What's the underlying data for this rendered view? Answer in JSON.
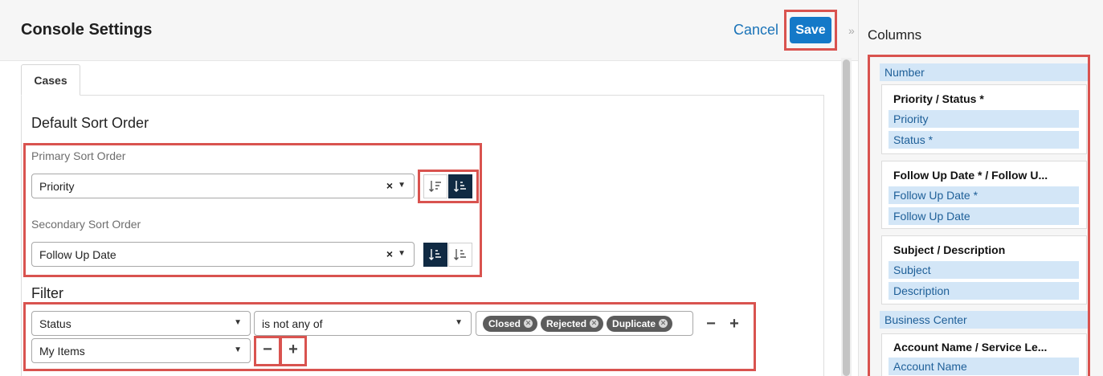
{
  "header": {
    "title": "Console Settings",
    "cancel_label": "Cancel",
    "save_label": "Save",
    "collapse_icon": "»"
  },
  "tabs": [
    {
      "label": "Cases"
    }
  ],
  "sort": {
    "section_title": "Default Sort Order",
    "primary": {
      "label": "Primary Sort Order",
      "value": "Priority"
    },
    "secondary": {
      "label": "Secondary Sort Order",
      "value": "Follow Up Date"
    }
  },
  "filter": {
    "section_title": "Filter",
    "rows": [
      {
        "field": "Status",
        "operator": "is not any of",
        "values": [
          "Closed",
          "Rejected",
          "Duplicate"
        ]
      },
      {
        "field": "My Items"
      }
    ]
  },
  "columns": {
    "title": "Columns",
    "number": "Number",
    "group1": {
      "title": "Priority / Status *",
      "items": [
        "Priority",
        "Status *"
      ]
    },
    "group2": {
      "title": "Follow Up Date * / Follow U...",
      "items": [
        "Follow Up Date *",
        "Follow Up Date"
      ]
    },
    "group3": {
      "title": "Subject / Description",
      "items": [
        "Subject",
        "Description"
      ]
    },
    "business_center": "Business Center",
    "group4": {
      "title": "Account Name / Service Le...",
      "items": [
        "Account Name"
      ]
    }
  },
  "icons": {
    "clear": "×",
    "caret": "▼",
    "minus": "−",
    "plus": "+"
  },
  "colors": {
    "accent": "#1479c8",
    "highlight": "#d9534f",
    "active_sort": "#102a43",
    "column_item": "#d3e6f7"
  }
}
